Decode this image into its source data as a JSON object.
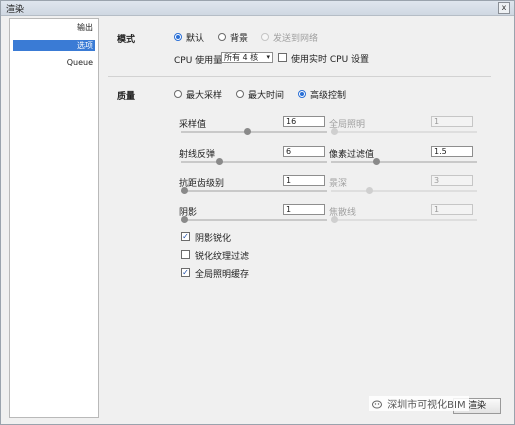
{
  "window": {
    "title": "渲染",
    "close_glyph": "x"
  },
  "sidebar": {
    "items": [
      {
        "label": "输出",
        "selected": false
      },
      {
        "label": "选项",
        "selected": true
      },
      {
        "label": "Queue",
        "selected": false
      }
    ]
  },
  "mode": {
    "label": "模式",
    "options": [
      {
        "label": "默认",
        "checked": true,
        "disabled": false
      },
      {
        "label": "背景",
        "checked": false,
        "disabled": false
      },
      {
        "label": "发送到网络",
        "checked": false,
        "disabled": true
      }
    ],
    "cpu_label": "CPU 使用量",
    "cpu_value": "所有 4 核",
    "realtime_label": "使用实时 CPU 设置",
    "realtime_checked": false
  },
  "quality": {
    "label": "质量",
    "options": [
      {
        "label": "最大采样",
        "checked": false
      },
      {
        "label": "最大时间",
        "checked": false
      },
      {
        "label": "高级控制",
        "checked": true
      }
    ],
    "params": [
      {
        "label": "采样值",
        "value": "16",
        "disabled": false,
        "level": 0.45
      },
      {
        "label": "全局照明",
        "value": "1",
        "disabled": true,
        "level": 0.0
      },
      {
        "label": "射线反弹",
        "value": "6",
        "disabled": false,
        "level": 0.25
      },
      {
        "label": "像素过滤值",
        "value": "1.5",
        "disabled": false,
        "level": 0.3
      },
      {
        "label": "抗距齿级别",
        "value": "1",
        "disabled": false,
        "level": 0.0
      },
      {
        "label": "景深",
        "value": "3",
        "disabled": true,
        "level": 0.25
      },
      {
        "label": "阴影",
        "value": "1",
        "disabled": false,
        "level": 0.0
      },
      {
        "label": "焦散线",
        "value": "1",
        "disabled": true,
        "level": 0.0
      }
    ],
    "checks": [
      {
        "label": "阴影锐化",
        "checked": true
      },
      {
        "label": "锐化纹理过滤",
        "checked": false
      },
      {
        "label": "全局照明缓存",
        "checked": true
      }
    ]
  },
  "footer": {
    "button_label": "渲染"
  },
  "watermark": {
    "text": "深圳市可视化BIM"
  },
  "colors": {
    "accent": "#2a6fd6",
    "selection": "#3a7bd5"
  }
}
